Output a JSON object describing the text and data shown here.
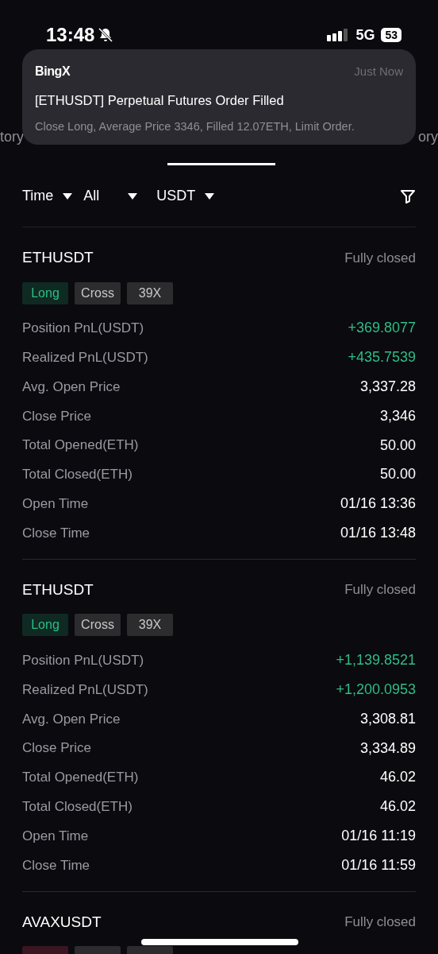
{
  "status_bar": {
    "time": "13:48",
    "network": "5G",
    "battery": "53",
    "silent": true
  },
  "notification": {
    "app": "BingX",
    "time": "Just Now",
    "title": "[ETHUSDT] Perpetual Futures Order Filled",
    "body": "Close Long, Average Price 3346, Filled 12.07ETH, Limit Order."
  },
  "tabs": [
    {
      "label": "tory",
      "selected": false
    },
    {
      "selected": true
    },
    {
      "label": "ory",
      "selected": false
    }
  ],
  "filters": [
    {
      "label": "Time"
    },
    {
      "label": "All"
    },
    {
      "label": "USDT"
    }
  ],
  "positions": [
    {
      "symbol": "ETHUSDT",
      "status": "Fully closed",
      "tags": [
        {
          "label": "Long",
          "kind": "long"
        },
        {
          "label": "Cross",
          "kind": "plain"
        },
        {
          "label": "39X",
          "kind": "plain"
        }
      ],
      "rows": [
        {
          "label": "Position PnL(USDT)",
          "value": "+369.8077",
          "kind": "positive"
        },
        {
          "label": "Realized PnL(USDT)",
          "value": "+435.7539",
          "kind": "positive"
        },
        {
          "label": "Avg. Open Price",
          "value": "3,337.28",
          "kind": "plain"
        },
        {
          "label": "Close Price",
          "value": "3,346",
          "kind": "plain"
        },
        {
          "label": "Total Opened(ETH)",
          "value": "50.00",
          "kind": "plain"
        },
        {
          "label": "Total Closed(ETH)",
          "value": "50.00",
          "kind": "plain"
        },
        {
          "label": "Open Time",
          "value": "01/16 13:36",
          "kind": "plain"
        },
        {
          "label": "Close Time",
          "value": "01/16 13:48",
          "kind": "plain"
        }
      ]
    },
    {
      "symbol": "ETHUSDT",
      "status": "Fully closed",
      "tags": [
        {
          "label": "Long",
          "kind": "long"
        },
        {
          "label": "Cross",
          "kind": "plain"
        },
        {
          "label": "39X",
          "kind": "plain"
        }
      ],
      "rows": [
        {
          "label": "Position PnL(USDT)",
          "value": "+1,139.8521",
          "kind": "positive"
        },
        {
          "label": "Realized PnL(USDT)",
          "value": "+1,200.0953",
          "kind": "positive"
        },
        {
          "label": "Avg. Open Price",
          "value": "3,308.81",
          "kind": "plain"
        },
        {
          "label": "Close Price",
          "value": "3,334.89",
          "kind": "plain"
        },
        {
          "label": "Total Opened(ETH)",
          "value": "46.02",
          "kind": "plain"
        },
        {
          "label": "Total Closed(ETH)",
          "value": "46.02",
          "kind": "plain"
        },
        {
          "label": "Open Time",
          "value": "01/16 11:19",
          "kind": "plain"
        },
        {
          "label": "Close Time",
          "value": "01/16 11:59",
          "kind": "plain"
        }
      ]
    },
    {
      "symbol": "AVAXUSDT",
      "status": "Fully closed",
      "tags": [
        {
          "kind": "short"
        },
        {
          "kind": "plain"
        },
        {
          "kind": "plain"
        }
      ]
    }
  ]
}
